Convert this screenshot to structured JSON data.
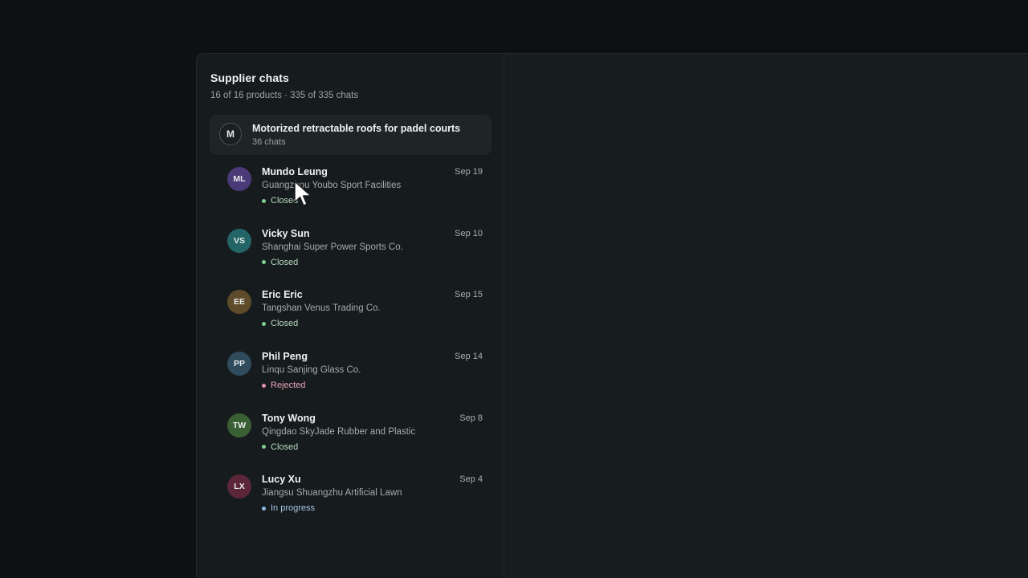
{
  "sidebar": {
    "title": "Supplier chats",
    "subtitle": "16 of 16 products · 335 of 335 chats"
  },
  "product_group": {
    "avatar_letter": "M",
    "name": "Motorized retractable roofs for padel courts",
    "count": "36 chats"
  },
  "status_colors": {
    "Closed": "#7fcf92",
    "Rejected": "#e58fa4",
    "In progress": "#8fb8e8"
  },
  "status_text_colors": {
    "Closed": "#b8d9c0",
    "Rejected": "#e9a6b6",
    "In progress": "#a9c6e8"
  },
  "chats": [
    {
      "initials": "ML",
      "name": "Mundo Leung",
      "company": "Guangzhou Youbo Sport Facilities",
      "status": "Closed",
      "date": "Sep 19",
      "avatar_color": "#4b3a78"
    },
    {
      "initials": "VS",
      "name": "Vicky Sun",
      "company": "Shanghai Super Power Sports Co.",
      "status": "Closed",
      "date": "Sep 10",
      "avatar_color": "#236566"
    },
    {
      "initials": "EE",
      "name": "Eric Eric",
      "company": "Tangshan Venus Trading Co.",
      "status": "Closed",
      "date": "Sep 15",
      "avatar_color": "#5e4b2a"
    },
    {
      "initials": "PP",
      "name": "Phil Peng",
      "company": "Linqu Sanjing Glass Co.",
      "status": "Rejected",
      "date": "Sep 14",
      "avatar_color": "#2f4b5c"
    },
    {
      "initials": "TW",
      "name": "Tony Wong",
      "company": "Qingdao SkyJade Rubber and Plastic",
      "status": "Closed",
      "date": "Sep 8",
      "avatar_color": "#3b5f34"
    },
    {
      "initials": "LX",
      "name": "Lucy Xu",
      "company": "Jiangsu Shuangzhu Artificial Lawn",
      "status": "In progress",
      "date": "Sep 4",
      "avatar_color": "#5a2638"
    }
  ]
}
